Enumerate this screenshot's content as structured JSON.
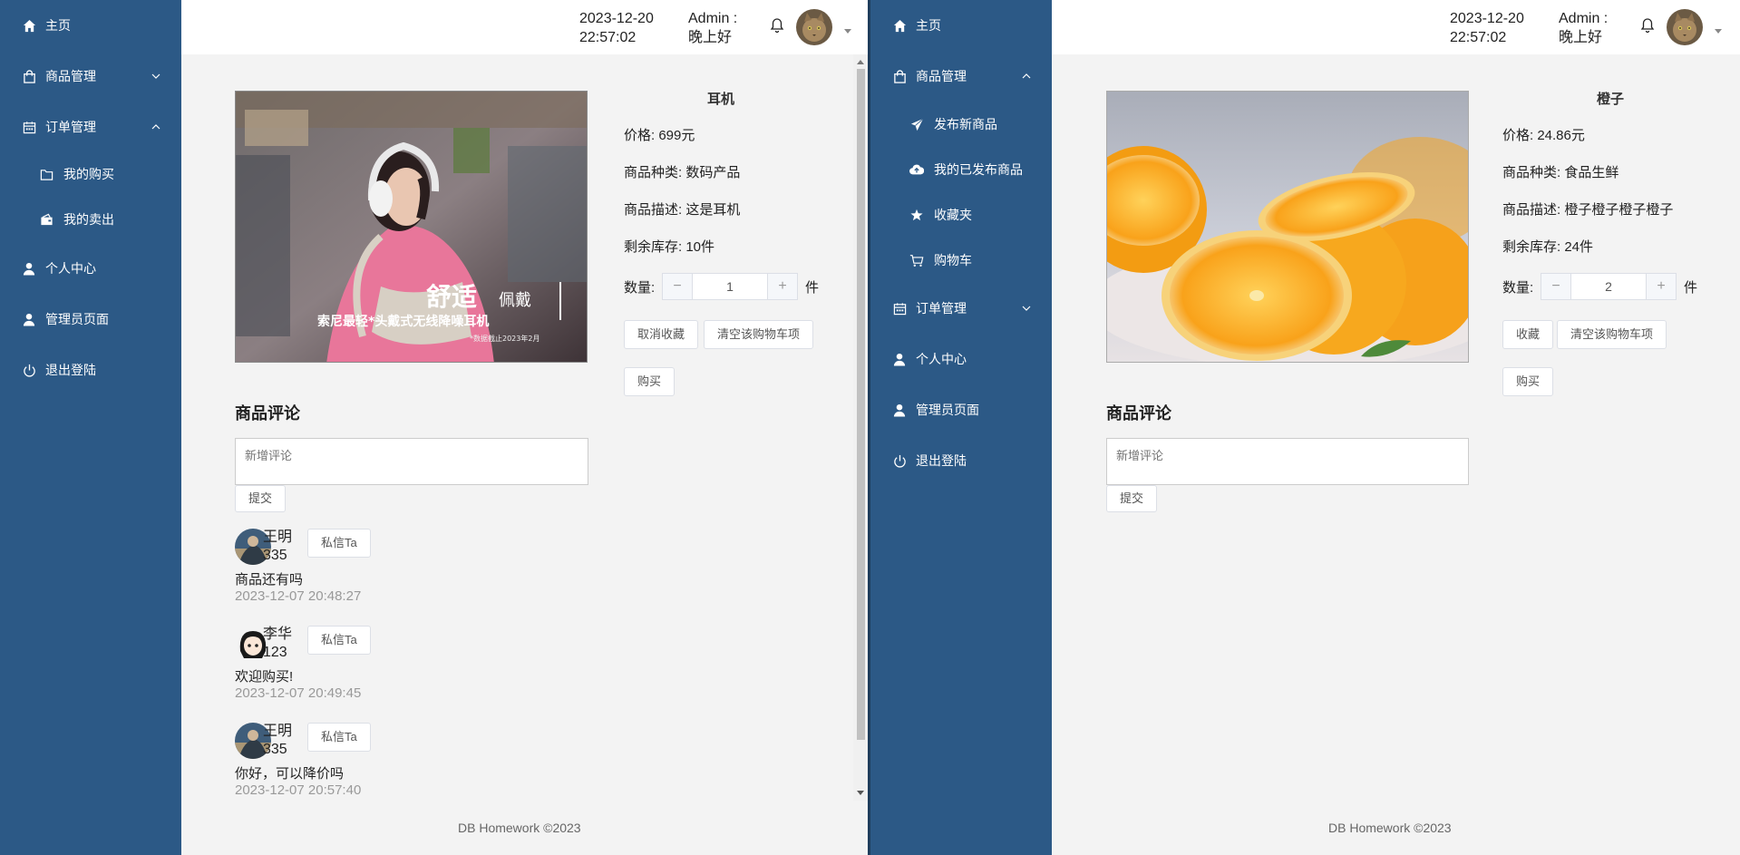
{
  "footer_text": "DB Homework ©2023",
  "left": {
    "sidebar": {
      "home": "主页",
      "goods_mgmt": "商品管理",
      "order_mgmt": "订单管理",
      "my_purchases": "我的购买",
      "my_sales": "我的卖出",
      "personal_center": "个人中心",
      "admin_page": "管理员页面",
      "logout": "退出登陆"
    },
    "header": {
      "date": "2023-12-20",
      "time": "22:57:02",
      "greeting": "Admin : 晚上好"
    },
    "product": {
      "name": "耳机",
      "price": "价格: 699元",
      "category": "商品种类: 数码产品",
      "description": "商品描述: 这是耳机",
      "stock": "剩余库存: 10件",
      "quantity_label": "数量:",
      "quantity": "1",
      "quantity_unit": "件",
      "fav_button": "取消收藏",
      "clear_cart_button": "清空该购物车项",
      "buy_button": "购买",
      "image_text_big": "舒适",
      "image_text_small": "佩戴",
      "image_text_sub": "索尼最轻*头戴式无线降噪耳机",
      "image_text_note": "*数据截止2023年2月"
    },
    "reviews": {
      "title": "商品评论",
      "placeholder": "新增评论",
      "submit": "提交",
      "message_button": "私信Ta",
      "items": [
        {
          "user": "王明335",
          "text": "商品还有吗",
          "time": "2023-12-07 20:48:27"
        },
        {
          "user": "李华123",
          "text": "欢迎购买!",
          "time": "2023-12-07 20:49:45"
        },
        {
          "user": "王明335",
          "text": "你好，可以降价吗",
          "time": "2023-12-07 20:57:40"
        }
      ]
    }
  },
  "right": {
    "sidebar": {
      "home": "主页",
      "goods_mgmt": "商品管理",
      "publish": "发布新商品",
      "my_published": "我的已发布商品",
      "favorites": "收藏夹",
      "cart": "购物车",
      "order_mgmt": "订单管理",
      "personal_center": "个人中心",
      "admin_page": "管理员页面",
      "logout": "退出登陆"
    },
    "header": {
      "date": "2023-12-20",
      "time": "22:57:02",
      "greeting": "Admin : 晚上好"
    },
    "product": {
      "name": "橙子",
      "price": "价格: 24.86元",
      "category": "商品种类: 食品生鲜",
      "description": "商品描述: 橙子橙子橙子橙子",
      "stock": "剩余库存: 24件",
      "quantity_label": "数量:",
      "quantity": "2",
      "quantity_unit": "件",
      "fav_button": "收藏",
      "clear_cart_button": "清空该购物车项",
      "buy_button": "购买"
    },
    "reviews": {
      "title": "商品评论",
      "placeholder": "新增评论",
      "submit": "提交"
    }
  },
  "colors": {
    "sidebar": "#2c5986",
    "content_bg": "#f3f3f3",
    "header_bg": "#ffffff"
  }
}
